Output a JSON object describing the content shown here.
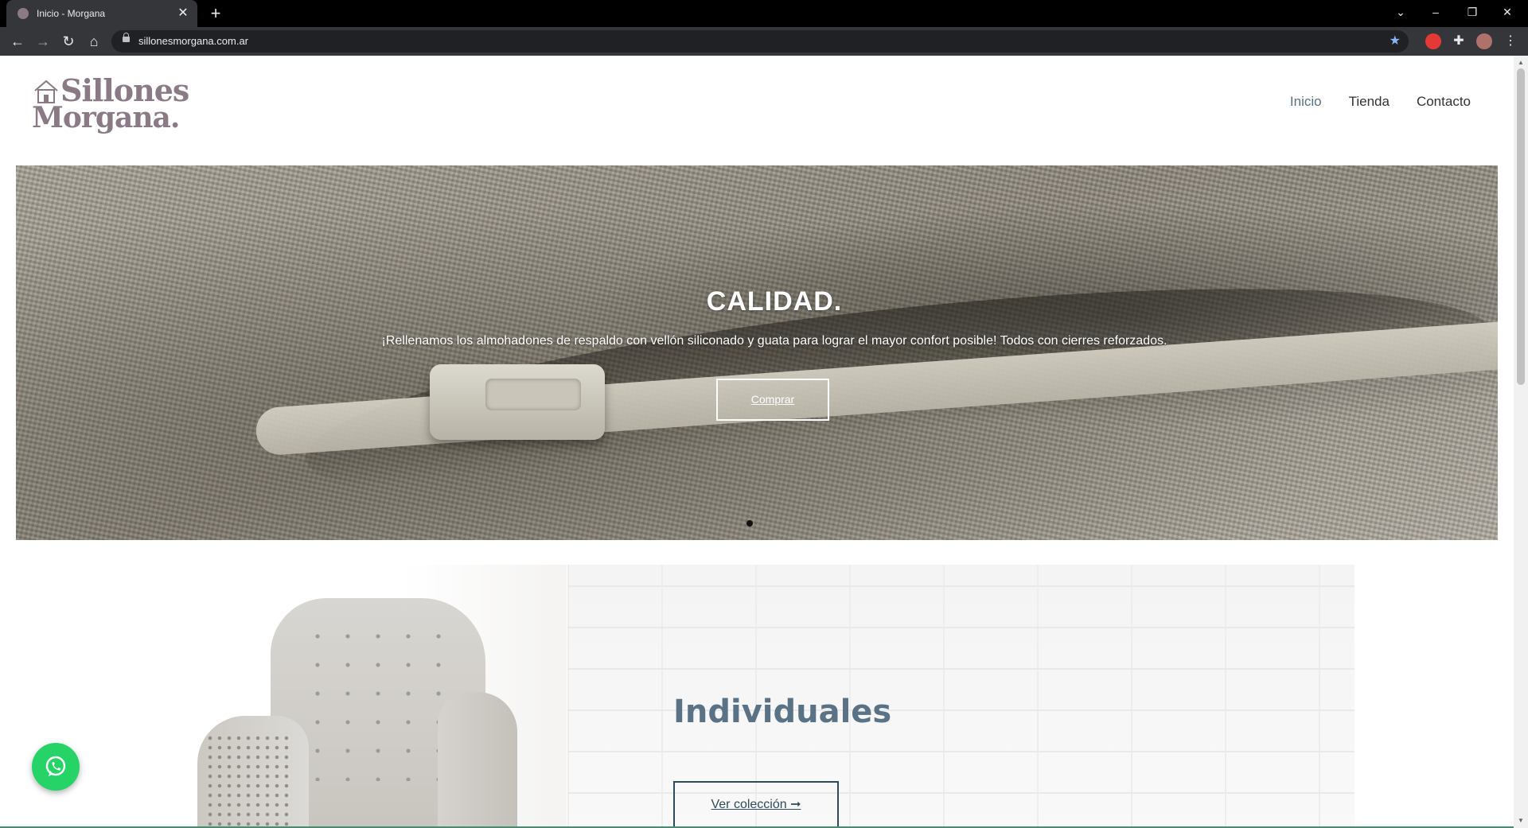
{
  "browser": {
    "tab_title": "Inicio - Morgana",
    "tab_close": "✕",
    "new_tab": "+",
    "url": "sillonesmorgana.com.ar",
    "window_controls": {
      "tab_search": "⌄",
      "minimize": "–",
      "restore": "❐",
      "close": "✕"
    },
    "nav": {
      "back": "←",
      "forward": "→",
      "reload": "↻",
      "home": "⌂"
    },
    "bookmark_star": "★"
  },
  "site": {
    "logo": {
      "line1": "Sillones",
      "line2": "Morgana.",
      "color": "#8a7a86"
    },
    "nav": [
      {
        "label": "Inicio",
        "active": true
      },
      {
        "label": "Tienda",
        "active": false
      },
      {
        "label": "Contacto",
        "active": false
      }
    ],
    "hero": {
      "title": "CALIDAD.",
      "text": "¡Rellenamos los almohadones de respaldo con vellón siliconado y guata para lograr el mayor confort posible! Todos con cierres reforzados.",
      "button": "Comprar",
      "slide_count": 1,
      "active_slide": 1
    },
    "collection": {
      "title": "Individuales",
      "button": "Ver colección ➞"
    },
    "accent_color": "#5a7285",
    "whatsapp_color": "#25d366"
  }
}
